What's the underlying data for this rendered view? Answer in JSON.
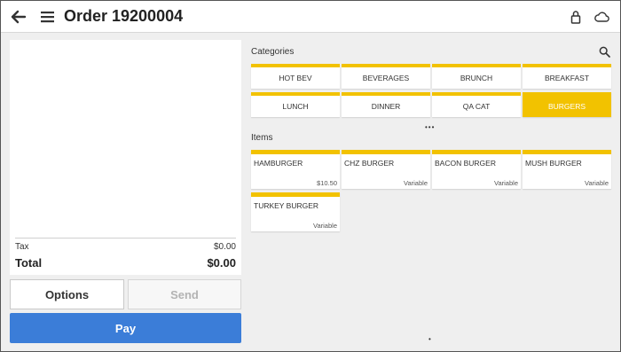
{
  "header": {
    "title": "Order 19200004",
    "icons": {
      "back": "back-arrow-icon",
      "menu": "hamburger-menu-icon",
      "lock": "lock-icon",
      "cloud": "cloud-icon"
    }
  },
  "ticket": {
    "tax_label": "Tax",
    "tax_value": "$0.00",
    "total_label": "Total",
    "total_value": "$0.00"
  },
  "actions": {
    "options_label": "Options",
    "send_label": "Send",
    "pay_label": "Pay"
  },
  "categories": {
    "label": "Categories",
    "items": [
      {
        "label": "HOT BEV"
      },
      {
        "label": "BEVERAGES"
      },
      {
        "label": "BRUNCH"
      },
      {
        "label": "BREAKFAST"
      },
      {
        "label": "LUNCH"
      },
      {
        "label": "DINNER"
      },
      {
        "label": "QA CAT"
      },
      {
        "label": "BURGERS"
      }
    ],
    "selected": "BURGERS",
    "pager": "•••"
  },
  "items": {
    "label": "Items",
    "list": [
      {
        "name": "HAMBURGER",
        "price": "$10.50"
      },
      {
        "name": "CHZ BURGER",
        "price": "Variable"
      },
      {
        "name": "BACON BURGER",
        "price": "Variable"
      },
      {
        "name": "MUSH BURGER",
        "price": "Variable"
      },
      {
        "name": "TURKEY BURGER",
        "price": "Variable"
      }
    ],
    "pager": "•"
  },
  "colors": {
    "accent": "#f2c200",
    "pay": "#3b7dd8",
    "background": "#efefef"
  }
}
